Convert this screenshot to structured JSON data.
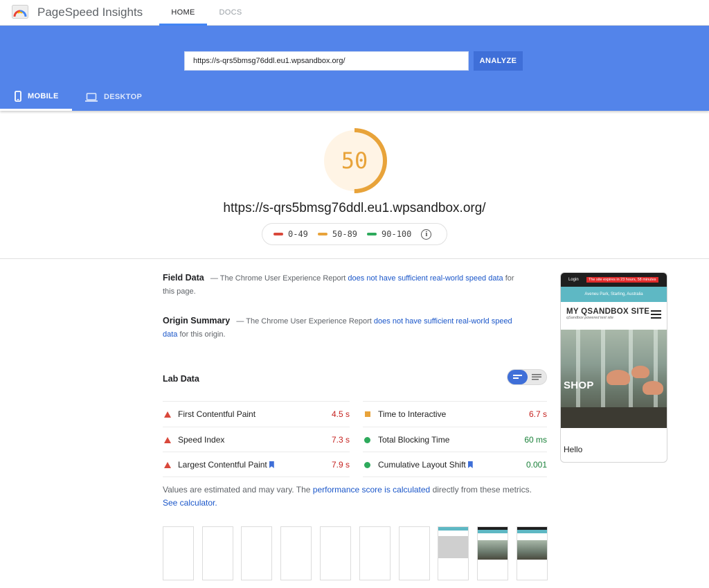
{
  "header": {
    "brand": "PageSpeed Insights",
    "tabs": {
      "home": "HOME",
      "docs": "DOCS"
    }
  },
  "search": {
    "url_value": "https://s-qrs5bmsg76ddl.eu1.wpsandbox.org/",
    "analyze_label": "ANALYZE"
  },
  "device_tabs": {
    "mobile": "MOBILE",
    "desktop": "DESKTOP"
  },
  "score": {
    "value": "50",
    "fraction": 0.5,
    "color": "#e8a33a",
    "url": "https://s-qrs5bmsg76ddl.eu1.wpsandbox.org/"
  },
  "legend": {
    "poor": {
      "label": "0-49",
      "color": "#d9483b"
    },
    "average": {
      "label": "50-89",
      "color": "#e8a33a"
    },
    "good": {
      "label": "90-100",
      "color": "#2eaa5c"
    }
  },
  "field_data": {
    "title": "Field Data",
    "pre": "— The Chrome User Experience Report",
    "link": "does not have sufficient real-world speed data",
    "post": "for this page."
  },
  "origin_summary": {
    "title": "Origin Summary",
    "pre": "— The Chrome User Experience Report",
    "link": "does not have sufficient real-world speed data",
    "post": "for this origin."
  },
  "lab_data": {
    "title": "Lab Data",
    "metrics": [
      {
        "label": "First Contentful Paint",
        "value": "4.5 s",
        "status": "poor",
        "color": "#c5221f"
      },
      {
        "label": "Time to Interactive",
        "value": "6.7 s",
        "status": "average",
        "color": "#c5221f"
      },
      {
        "label": "Speed Index",
        "value": "7.3 s",
        "status": "poor",
        "color": "#c5221f"
      },
      {
        "label": "Total Blocking Time",
        "value": "60 ms",
        "status": "good",
        "color": "#188038"
      },
      {
        "label": "Largest Contentful Paint",
        "value": "7.9 s",
        "status": "poor",
        "color": "#c5221f"
      },
      {
        "label": "Cumulative Layout Shift",
        "value": "0.001",
        "status": "good",
        "color": "#188038"
      }
    ]
  },
  "values_note": {
    "pre": "Values are estimated and may vary. The",
    "link1": "performance score is calculated",
    "mid": "directly from these metrics.",
    "link2": "See calculator."
  },
  "phone_preview": {
    "login": "Login",
    "expire": "The site expires in 23 hours, 58 minutes",
    "address": "Aveneu Park, Starling, Australia",
    "site_title": "MY QSANDBOX SITE",
    "site_sub": "qSandbox powered test site",
    "hero_text": "SHOP",
    "hello": "Hello"
  }
}
